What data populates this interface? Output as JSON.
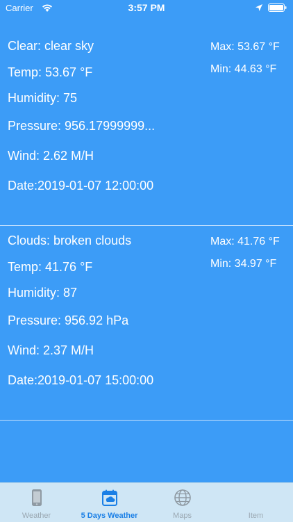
{
  "status_bar": {
    "carrier": "Carrier",
    "time": "3:57 PM"
  },
  "forecasts": [
    {
      "condition": "Clear: clear sky",
      "temp": "Temp: 53.67 °F",
      "humidity": "Humidity: 75",
      "pressure": "Pressure: 956.17999999...",
      "wind": "Wind: 2.62 M/H",
      "date": "Date:2019-01-07 12:00:00",
      "max": "Max: 53.67 °F",
      "min": "Min: 44.63 °F"
    },
    {
      "condition": "Clouds: broken clouds",
      "temp": "Temp: 41.76 °F",
      "humidity": "Humidity: 87",
      "pressure": "Pressure: 956.92 hPa",
      "wind": "Wind: 2.37 M/H",
      "date": "Date:2019-01-07 15:00:00",
      "max": "Max: 41.76 °F",
      "min": "Min: 34.97 °F"
    }
  ],
  "tabs": [
    {
      "label": "Weather",
      "icon": "phone-icon",
      "active": false
    },
    {
      "label": "5 Days Weather",
      "icon": "calendar-icon",
      "active": true
    },
    {
      "label": "Maps",
      "icon": "globe-icon",
      "active": false
    },
    {
      "label": "Item",
      "icon": "item-icon",
      "active": false
    }
  ],
  "colors": {
    "background": "#3c9cf7",
    "tab_bar": "#cfe6f5",
    "tab_active": "#1a7fe6",
    "tab_inactive": "#9aa7b1"
  }
}
